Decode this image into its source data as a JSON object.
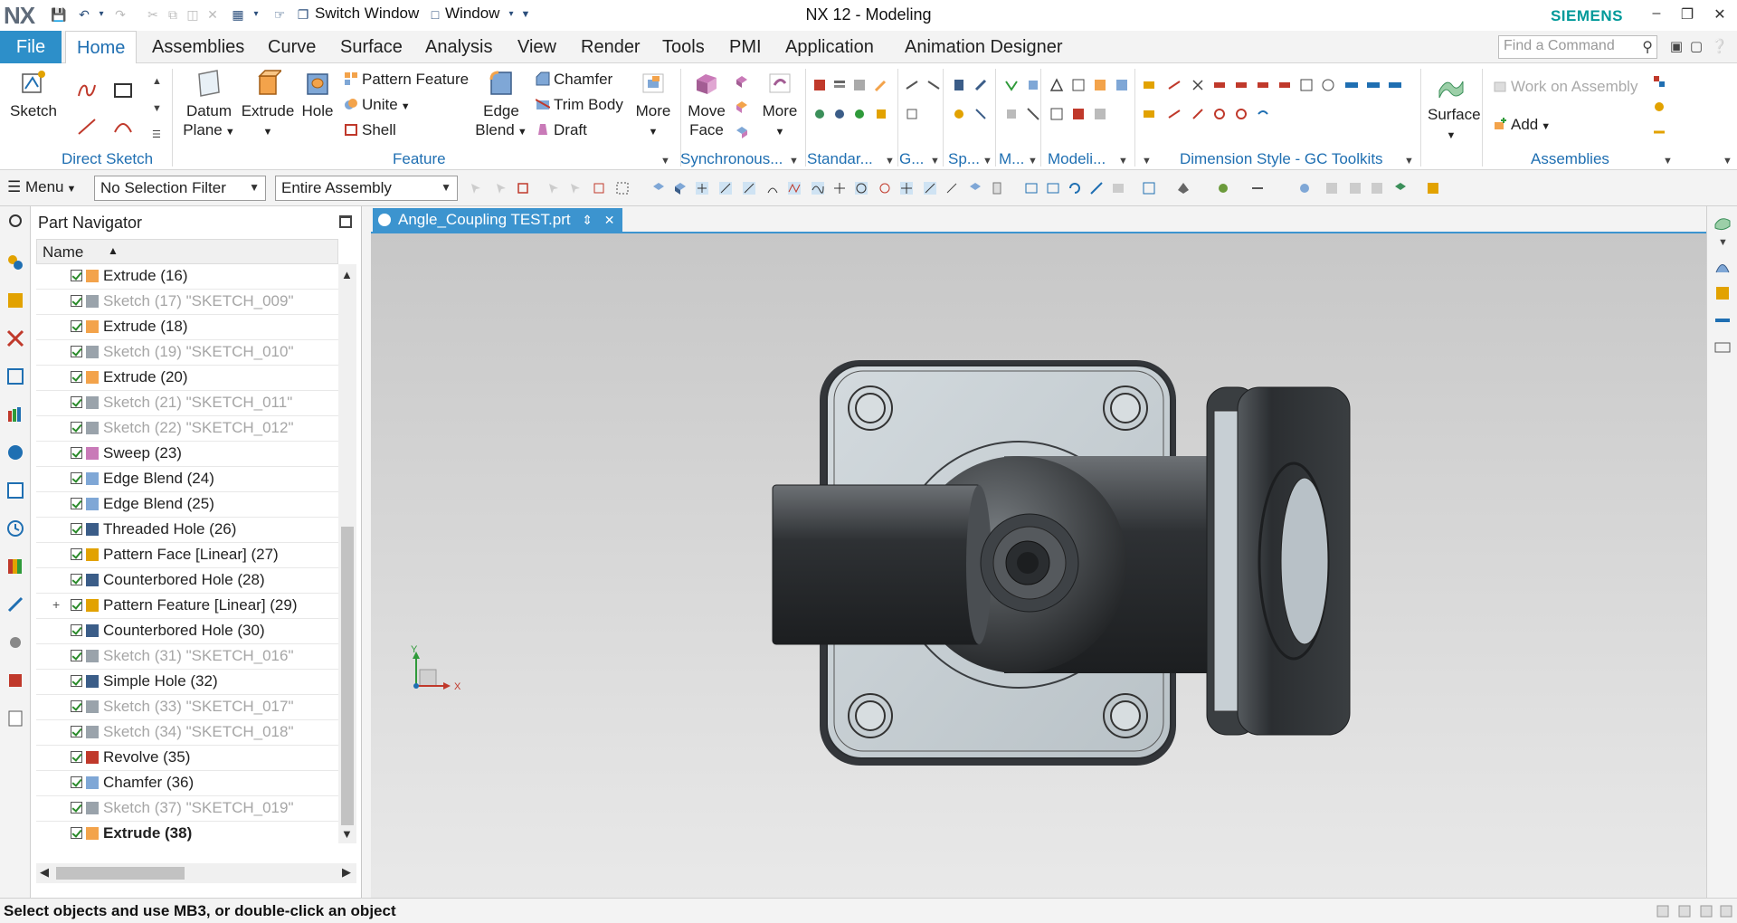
{
  "app": {
    "logo": "NX",
    "title": "NX 12 - Modeling",
    "brand": "SIEMENS",
    "switch_window": "Switch Window",
    "window_menu": "Window"
  },
  "tabs": {
    "file": "File",
    "items": [
      "Home",
      "Assemblies",
      "Curve",
      "Surface",
      "Analysis",
      "View",
      "Render",
      "Tools",
      "PMI",
      "Application",
      "Animation Designer"
    ],
    "active": "Home",
    "find_command_placeholder": "Find a Command"
  },
  "ribbon": {
    "direct_sketch": {
      "label": "Direct Sketch",
      "sketch": "Sketch"
    },
    "feature": {
      "label": "Feature",
      "datum_plane": [
        "Datum",
        "Plane"
      ],
      "extrude": "Extrude",
      "hole": "Hole",
      "pattern_feature": "Pattern Feature",
      "unite": "Unite",
      "shell": "Shell",
      "edge_blend": [
        "Edge",
        "Blend"
      ],
      "chamfer": "Chamfer",
      "trim_body": "Trim Body",
      "draft": "Draft",
      "more": "More"
    },
    "synchronous": {
      "label": "Synchronous...",
      "move_face": [
        "Move",
        "Face"
      ],
      "more": "More"
    },
    "standard": {
      "label": "Standar..."
    },
    "g": {
      "label": "G..."
    },
    "sp": {
      "label": "Sp..."
    },
    "m": {
      "label": "M..."
    },
    "modeling": {
      "label": "Modeli..."
    },
    "dimension_style": {
      "label": "Dimension Style - GC Toolkits"
    },
    "surface": {
      "label": "Surface"
    },
    "assemblies": {
      "label": "Assemblies",
      "work_on_assembly": "Work on Assembly",
      "add": "Add"
    }
  },
  "selection_bar": {
    "menu": "Menu",
    "filter": "No Selection Filter",
    "scope": "Entire Assembly"
  },
  "navigator": {
    "title": "Part Navigator",
    "column": "Name",
    "rows": [
      {
        "label": "Extrude (16)",
        "dim": false,
        "bold": false,
        "icon": "extrude-icon",
        "expand": ""
      },
      {
        "label": "Sketch (17) \"SKETCH_009\"",
        "dim": true,
        "bold": false,
        "icon": "sketch-icon",
        "expand": ""
      },
      {
        "label": "Extrude (18)",
        "dim": false,
        "bold": false,
        "icon": "extrude-icon",
        "expand": ""
      },
      {
        "label": "Sketch (19) \"SKETCH_010\"",
        "dim": true,
        "bold": false,
        "icon": "sketch-icon",
        "expand": ""
      },
      {
        "label": "Extrude (20)",
        "dim": false,
        "bold": false,
        "icon": "extrude-icon",
        "expand": ""
      },
      {
        "label": "Sketch (21) \"SKETCH_011\"",
        "dim": true,
        "bold": false,
        "icon": "sketch-icon",
        "expand": ""
      },
      {
        "label": "Sketch (22) \"SKETCH_012\"",
        "dim": true,
        "bold": false,
        "icon": "sketch-icon",
        "expand": ""
      },
      {
        "label": "Sweep (23)",
        "dim": false,
        "bold": false,
        "icon": "sweep-icon",
        "expand": ""
      },
      {
        "label": "Edge Blend (24)",
        "dim": false,
        "bold": false,
        "icon": "edge-blend-icon",
        "expand": ""
      },
      {
        "label": "Edge Blend (25)",
        "dim": false,
        "bold": false,
        "icon": "edge-blend-icon",
        "expand": ""
      },
      {
        "label": "Threaded Hole (26)",
        "dim": false,
        "bold": false,
        "icon": "hole-icon",
        "expand": ""
      },
      {
        "label": "Pattern Face [Linear] (27)",
        "dim": false,
        "bold": false,
        "icon": "pattern-icon",
        "expand": ""
      },
      {
        "label": "Counterbored Hole (28)",
        "dim": false,
        "bold": false,
        "icon": "hole-icon",
        "expand": ""
      },
      {
        "label": "Pattern Feature [Linear] (29)",
        "dim": false,
        "bold": false,
        "icon": "pattern-icon",
        "expand": "+"
      },
      {
        "label": "Counterbored Hole (30)",
        "dim": false,
        "bold": false,
        "icon": "hole-icon",
        "expand": ""
      },
      {
        "label": "Sketch (31) \"SKETCH_016\"",
        "dim": true,
        "bold": false,
        "icon": "sketch-icon",
        "expand": ""
      },
      {
        "label": "Simple Hole (32)",
        "dim": false,
        "bold": false,
        "icon": "hole-icon",
        "expand": ""
      },
      {
        "label": "Sketch (33) \"SKETCH_017\"",
        "dim": true,
        "bold": false,
        "icon": "sketch-icon",
        "expand": ""
      },
      {
        "label": "Sketch (34) \"SKETCH_018\"",
        "dim": true,
        "bold": false,
        "icon": "sketch-icon",
        "expand": ""
      },
      {
        "label": "Revolve (35)",
        "dim": false,
        "bold": false,
        "icon": "revolve-icon",
        "expand": ""
      },
      {
        "label": "Chamfer (36)",
        "dim": false,
        "bold": false,
        "icon": "chamfer-icon",
        "expand": ""
      },
      {
        "label": "Sketch (37) \"SKETCH_019\"",
        "dim": true,
        "bold": false,
        "icon": "sketch-icon",
        "expand": ""
      },
      {
        "label": "Extrude (38)",
        "dim": false,
        "bold": true,
        "icon": "extrude-icon",
        "expand": ""
      }
    ]
  },
  "document": {
    "tab": "Angle_Coupling TEST.prt"
  },
  "triad": {
    "x": "X",
    "y": "Y"
  },
  "status": {
    "message": "Select objects and use MB3, or double-click an object"
  },
  "colors": {
    "accent": "#2d8fc9",
    "group_label": "#1f6fb2",
    "brand": "#009999",
    "part_body": "#3c3f42",
    "part_face": "#c4ccd1"
  }
}
